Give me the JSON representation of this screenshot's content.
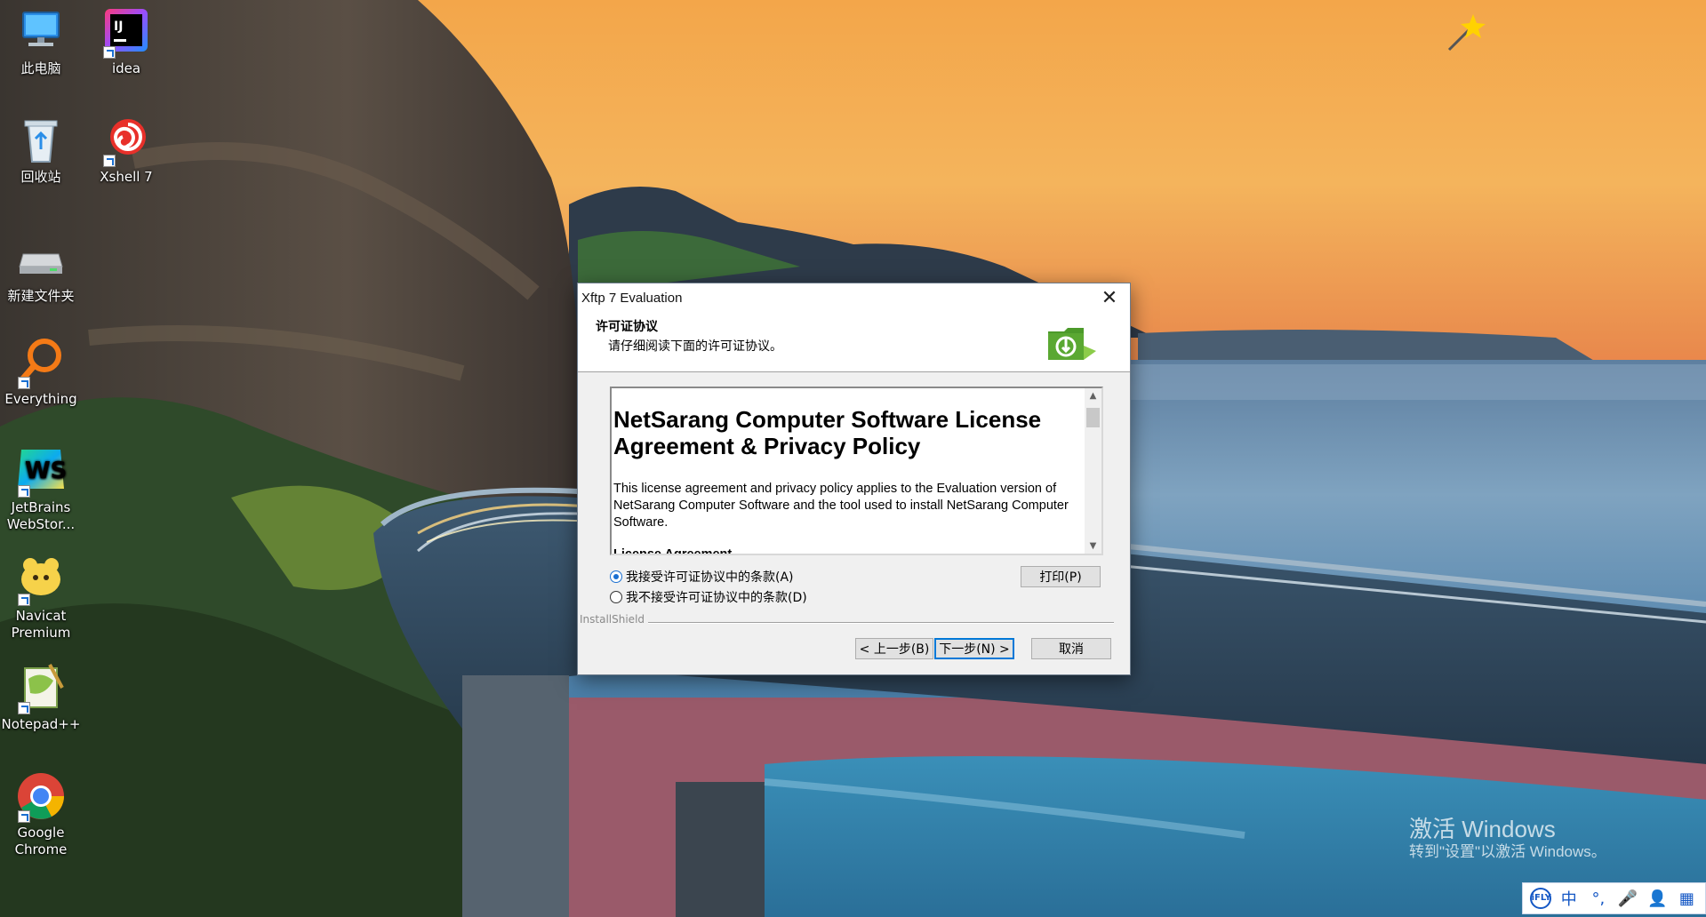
{
  "desktop": {
    "icons": [
      {
        "label": "此电脑"
      },
      {
        "label": "idea"
      },
      {
        "label": "回收站"
      },
      {
        "label": "Xshell 7"
      },
      {
        "label": "新建文件夹"
      },
      {
        "label": "Everything"
      },
      {
        "label": "JetBrains WebStor..."
      },
      {
        "label": "Navicat Premium"
      },
      {
        "label": "Notepad++"
      },
      {
        "label": "Google Chrome"
      }
    ]
  },
  "dialog": {
    "title": "Xftp 7 Evaluation",
    "close_glyph": "✕",
    "header_title": "许可证协议",
    "header_subtitle": "请仔细阅读下面的许可证协议。",
    "license": {
      "title": "NetSarang Computer Software License Agreement & Privacy Policy",
      "paragraph": "This license agreement and privacy policy applies to the Evaluation version of NetSarang Computer Software and the tool used to install NetSarang Computer Software.",
      "subheading": "License Agreement"
    },
    "radio_accept": "我接受许可证协议中的条款(A)",
    "radio_decline": "我不接受许可证协议中的条款(D)",
    "print_button": "打印(P)",
    "installshield": "InstallShield",
    "back_button": "< 上一步(B)",
    "next_button": "下一步(N) >",
    "cancel_button": "取消"
  },
  "watermark": {
    "line1": "激活 Windows",
    "line2": "转到\"设置\"以激活 Windows。"
  },
  "ime": {
    "items": [
      "iFLY",
      "中",
      "°,",
      "🎤",
      "👤",
      "▦"
    ]
  },
  "colors": {
    "accent": "#0078d7",
    "dialog_bg": "#f0f0f0",
    "logo_green": "#5aa832"
  }
}
